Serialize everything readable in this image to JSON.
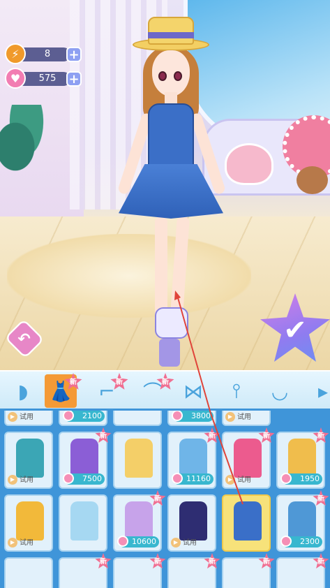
{
  "hud": {
    "energy": {
      "icon": "lightning-icon",
      "value": "8"
    },
    "gems": {
      "icon": "gem-icon",
      "value": "575"
    },
    "plus_label": "+"
  },
  "actions": {
    "back_symbol": "↶",
    "confirm_symbol": "✔"
  },
  "categories": [
    {
      "name": "hair",
      "icon": "hair-icon",
      "glyph": "◗",
      "is_new": false,
      "active": false
    },
    {
      "name": "dress",
      "icon": "dress-icon",
      "glyph": "👗",
      "is_new": true,
      "active": true
    },
    {
      "name": "stockings",
      "icon": "stocking-icon",
      "glyph": "⌐",
      "is_new": true,
      "active": false
    },
    {
      "name": "shoes",
      "icon": "high-heel-icon",
      "glyph": "⌒",
      "is_new": true,
      "active": false
    },
    {
      "name": "hair-accessory",
      "icon": "bow-icon",
      "glyph": "⋈",
      "is_new": false,
      "active": false
    },
    {
      "name": "earrings",
      "icon": "earring-icon",
      "glyph": "⫯",
      "is_new": false,
      "active": false
    },
    {
      "name": "necklace",
      "icon": "necklace-icon",
      "glyph": "◡",
      "is_new": false,
      "active": false
    },
    {
      "name": "more",
      "icon": "more-icon",
      "glyph": "▸",
      "is_new": false,
      "active": false
    }
  ],
  "new_badge": "新",
  "top_row_partial": [
    {
      "tag": "试用",
      "price": ""
    },
    {
      "tag": "",
      "price": "2100"
    },
    {
      "tag": "",
      "price": ""
    },
    {
      "tag": "",
      "price": "3800"
    },
    {
      "tag": "试用",
      "price": ""
    }
  ],
  "items_row1": [
    {
      "name": "teal-qipao",
      "color": "#3ba6b5",
      "tag": "试用",
      "price": "",
      "is_new": false
    },
    {
      "name": "purple-gown",
      "color": "#8b5ed6",
      "tag": "",
      "price": "7500",
      "is_new": true
    },
    {
      "name": "yellow-lolita",
      "color": "#f4cf68",
      "tag": "",
      "price": "",
      "is_new": false
    },
    {
      "name": "blue-layered-dress",
      "color": "#6fb5e8",
      "tag": "",
      "price": "11160",
      "is_new": true
    },
    {
      "name": "pink-layered-dress",
      "color": "#ec5b8e",
      "tag": "试用",
      "price": "",
      "is_new": true
    },
    {
      "name": "yellow-flower-dress",
      "color": "#f0bd4c",
      "tag": "",
      "price": "1950",
      "is_new": true
    }
  ],
  "items_row2": [
    {
      "name": "yellow-ruffle-dress",
      "color": "#f2b93a",
      "tag": "试用",
      "price": "",
      "is_new": false
    },
    {
      "name": "light-blue-shirt-dress",
      "color": "#a6d8f2",
      "tag": "",
      "price": "",
      "is_new": false
    },
    {
      "name": "lavender-ball-gown",
      "color": "#c7a3ea",
      "tag": "",
      "price": "10600",
      "is_new": true
    },
    {
      "name": "navy-evening-gown",
      "color": "#2e2d72",
      "tag": "试用",
      "price": "",
      "is_new": false
    },
    {
      "name": "blue-sailor-dress",
      "color": "#3a6fc8",
      "tag": "",
      "price": "",
      "is_new": false,
      "selected": true
    },
    {
      "name": "blue-bow-dress",
      "color": "#4f98d6",
      "tag": "",
      "price": "2300",
      "is_new": true
    }
  ]
}
